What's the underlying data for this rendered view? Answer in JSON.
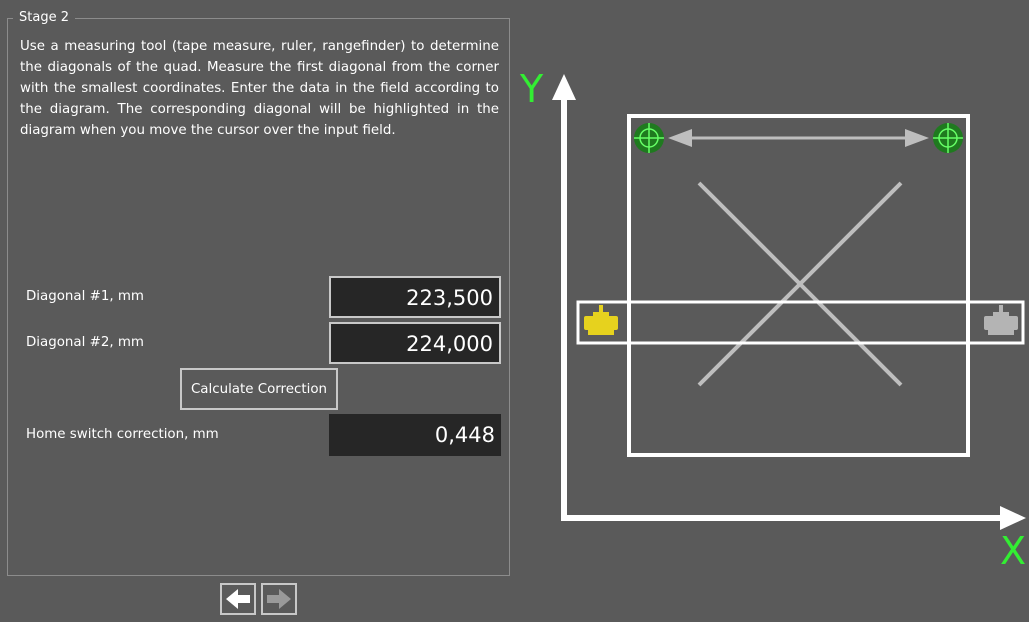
{
  "stage": {
    "title": "Stage 2"
  },
  "instructions": "Use a measuring tool (tape measure, ruler, rangefinder) to determine the diagonals of the quad. Measure the first diagonal from the corner with the smallest coordinates. Enter the data in the field according to the diagram. The corresponding diagonal will be highlighted in the diagram when you move the cursor over the input field.",
  "form": {
    "diagonal1": {
      "label": "Diagonal #1, mm",
      "value": "223,500"
    },
    "diagonal2": {
      "label": "Diagonal #2, mm",
      "value": "224,000"
    },
    "calculate_label": "Calculate Correction",
    "correction": {
      "label": "Home switch correction, mm",
      "value": "0,448"
    }
  },
  "navigation": {
    "back_icon": "arrow-left-icon",
    "forward_icon": "arrow-right-icon"
  },
  "diagram": {
    "y_axis_label": "Y",
    "x_axis_label": "X",
    "colors": {
      "axis_label": "#33ee33",
      "target": "#22aa22",
      "motor_active": "#e6d21e",
      "motor_inactive": "#b4b4b4",
      "diagonal": "#bebebe",
      "frame": "#ffffff"
    },
    "icons": [
      "crosshair-target-icon",
      "stepper-motor-icon",
      "double-arrow-icon"
    ]
  }
}
